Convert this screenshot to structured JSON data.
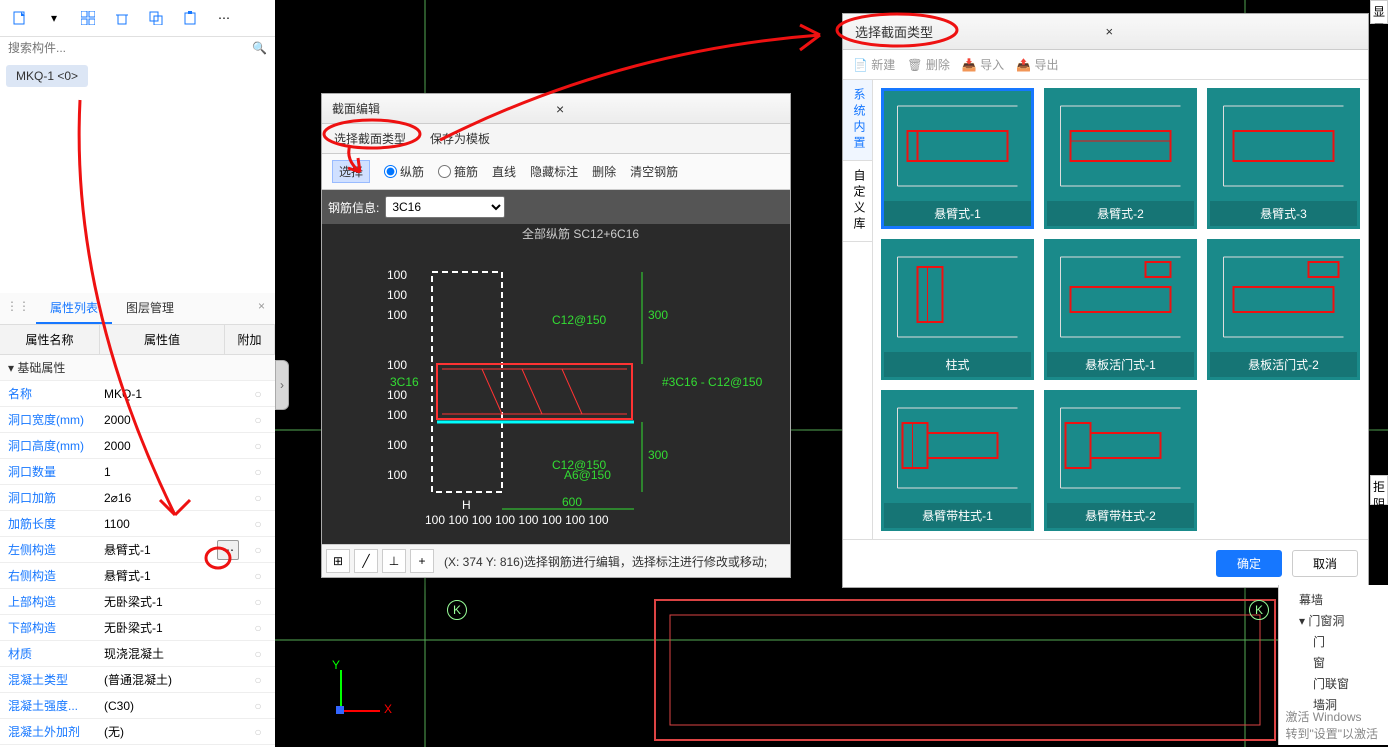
{
  "toolbar_icons": [
    "new",
    "grid",
    "delete",
    "copy",
    "paste",
    "more"
  ],
  "search_placeholder": "搜索构件...",
  "selected_item": "MKQ-1 <0>",
  "prop_tabs": {
    "list": "属性列表",
    "layer": "图层管理"
  },
  "prop_header": {
    "name": "属性名称",
    "value": "属性值",
    "extra": "附加"
  },
  "prop_group": "基础属性",
  "props": [
    {
      "name": "名称",
      "value": "MKQ-1"
    },
    {
      "name": "洞口宽度(mm)",
      "value": "2000"
    },
    {
      "name": "洞口高度(mm)",
      "value": "2000"
    },
    {
      "name": "洞口数量",
      "value": "1"
    },
    {
      "name": "洞口加筋",
      "value": "2⌀16"
    },
    {
      "name": "加筋长度",
      "value": "1100"
    },
    {
      "name": "左侧构造",
      "value": "悬臂式-1",
      "ellipsis": true
    },
    {
      "name": "右侧构造",
      "value": "悬臂式-1"
    },
    {
      "name": "上部构造",
      "value": "无卧梁式-1"
    },
    {
      "name": "下部构造",
      "value": "无卧梁式-1"
    },
    {
      "name": "材质",
      "value": "现浇混凝土"
    },
    {
      "name": "混凝土类型",
      "value": "(普通混凝土)"
    },
    {
      "name": "混凝土强度...",
      "value": "(C30)"
    },
    {
      "name": "混凝土外加剂",
      "value": "(无)"
    }
  ],
  "section_dialog": {
    "title": "截面编辑",
    "tabs": {
      "select_type": "选择截面类型",
      "save_tpl": "保存为模板"
    },
    "toolbar": {
      "select": "选择",
      "zongfen": "纵筋",
      "hoop": "箍筋",
      "line": "直线",
      "hide": "隐藏标注",
      "del": "删除",
      "clear": "清空钢筋"
    },
    "rebar_label": "钢筋信息:",
    "rebar_value": "3C16",
    "canvas_label": "全部纵筋  SC12+6C16",
    "dims": {
      "w": "600",
      "h": "300",
      "h2": "300"
    },
    "status": "(X: 374 Y: 816)选择钢筋进行编辑，选择标注进行修改或移动;"
  },
  "type_dialog": {
    "title": "选择截面类型",
    "toolbar": {
      "new": "新建",
      "del": "删除",
      "imp": "导入",
      "exp": "导出"
    },
    "sidebar": {
      "sys": "系统内置",
      "custom": "自定义库"
    },
    "cards": [
      "悬臂式-1",
      "悬臂式-2",
      "悬臂式-3",
      "柱式",
      "悬板活门式-1",
      "悬板活门式-2",
      "悬臂带柱式-1",
      "悬臂带柱式-2"
    ],
    "ok": "确定",
    "cancel": "取消"
  },
  "right_tree": {
    "items": [
      "幕墙",
      "门窗洞",
      "门",
      "窗",
      "门联窗",
      "墙洞"
    ]
  },
  "watermark": {
    "l1": "激活 Windows",
    "l2": "转到\"设置\"以激活"
  },
  "axis_k": "K",
  "right_label": "显示",
  "right_label2": "拒阴"
}
